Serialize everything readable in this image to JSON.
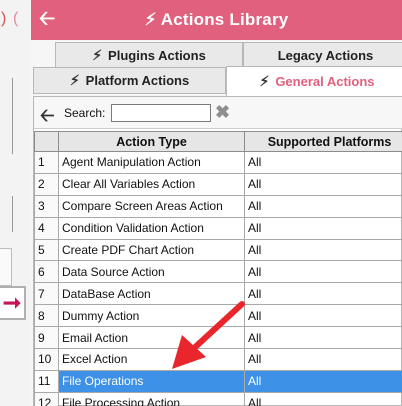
{
  "left_panel": {
    "icons": [
      "paren-icon",
      "paren-icon"
    ],
    "arrow_icon": "arrow-right-icon"
  },
  "window": {
    "back_icon": "arrow-left-icon",
    "title_icon": "bolt-icon",
    "title": "Actions Library"
  },
  "tabs": [
    {
      "label": "Plugins Actions",
      "icon": "plugin-bolt-icon"
    },
    {
      "label": "Legacy Actions",
      "icon": ""
    },
    {
      "label": "Platform Actions",
      "icon": "platform-bolt-icon"
    },
    {
      "label": "General Actions",
      "icon": "general-bolt-icon"
    }
  ],
  "search": {
    "label": "Search:",
    "value": "",
    "back_icon": "arrow-left-icon",
    "clear_icon": "clear-icon"
  },
  "table": {
    "columns": [
      "",
      "Action Type",
      "Supported Platforms"
    ],
    "rows": [
      {
        "num": "1",
        "type": "Agent Manipulation Action",
        "platforms": "All"
      },
      {
        "num": "2",
        "type": "Clear All Variables Action",
        "platforms": "All"
      },
      {
        "num": "3",
        "type": "Compare Screen Areas Action",
        "platforms": "All"
      },
      {
        "num": "4",
        "type": "Condition Validation Action",
        "platforms": "All"
      },
      {
        "num": "5",
        "type": "Create PDF Chart Action",
        "platforms": "All"
      },
      {
        "num": "6",
        "type": "Data Source Action",
        "platforms": "All"
      },
      {
        "num": "7",
        "type": "DataBase Action",
        "platforms": "All"
      },
      {
        "num": "8",
        "type": "Dummy Action",
        "platforms": "All"
      },
      {
        "num": "9",
        "type": "Email Action",
        "platforms": "All"
      },
      {
        "num": "10",
        "type": "Excel Action",
        "platforms": "All"
      },
      {
        "num": "11",
        "type": "File Operations",
        "platforms": "All"
      },
      {
        "num": "12",
        "type": "File Processing Action",
        "platforms": "All"
      }
    ],
    "selected_row": 11
  },
  "colors": {
    "title_bar": "#e0607e",
    "active_tab_text": "#e0607e",
    "selection": "#3d91e6",
    "annotation_arrow": "#e8262c"
  }
}
